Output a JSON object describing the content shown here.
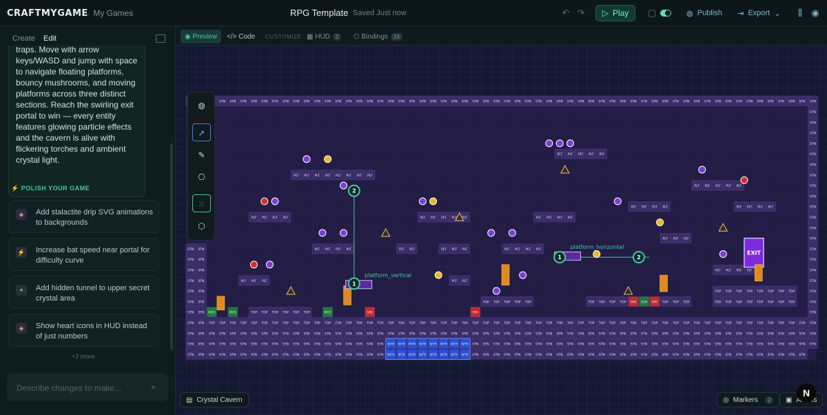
{
  "header": {
    "logo": "CRAFTMYGAME",
    "back": "My Games",
    "title": "RPG Template",
    "saved": "Saved Just now",
    "play": "Play",
    "publish": "Publish",
    "export": "Export"
  },
  "sidebar": {
    "tabs": [
      "Create",
      "Edit"
    ],
    "active_tab": "Edit",
    "description": "traps. Move with arrow keys/WASD and jump with space to navigate floating platforms, bouncy mushrooms, and moving platforms across three distinct sections. Reach the swirling exit portal to win — every entity features glowing particle effects and the cavern is alive with flickering torches and ambient crystal light.",
    "polish_heading": "POLISH YOUR GAME",
    "suggestions": [
      "Add stalactite drip SVG animations to backgrounds",
      "Increase bat speed near portal for difficulty curve",
      "Add hidden tunnel to upper secret crystal area",
      "Show heart icons in HUD instead of just numbers"
    ],
    "more": "+2 more",
    "chat_placeholder": "Describe changes to make..."
  },
  "subbar": {
    "preview": "Preview",
    "code": "Code",
    "customize": "CUSTOMIZE",
    "hud": "HUD",
    "hud_count": "2",
    "bindings": "Bindings",
    "bindings_count": "24"
  },
  "canvas": {
    "level_name": "Crystal Cavern",
    "markers": "Markers",
    "markers_count": "2",
    "assets": "Assets",
    "exit_label": "EXIT",
    "platform_vertical": "platform_vertical",
    "platform_horizontal": "platform_horizontal",
    "tile_labels": {
      "stone": "STN",
      "platform": "PLT",
      "top": "TOP",
      "water": "WTR",
      "mushroom": "MOS",
      "spike": "SPK",
      "slime": "SLM"
    }
  },
  "colors": {
    "accent": "#43c8a2",
    "canvas_bg": "#151832",
    "tile": "#3b2d66",
    "water": "#2a4fd6",
    "exit": "#7a2ad8"
  }
}
